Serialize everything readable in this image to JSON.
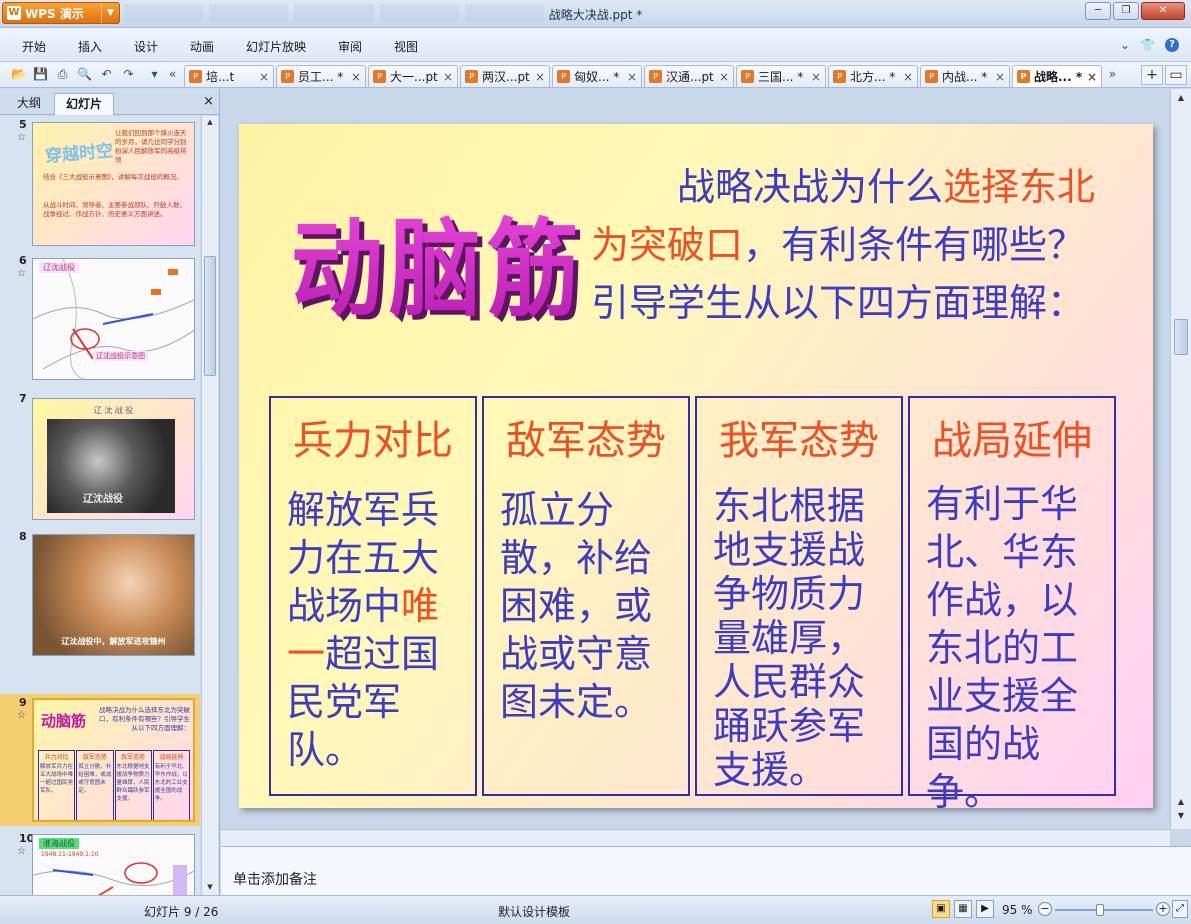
{
  "window": {
    "app_button": "WPS 演示",
    "title": "战略大决战.ppt *",
    "controls": [
      "─",
      "❐",
      "✕"
    ]
  },
  "menu": {
    "items": [
      "开始",
      "插入",
      "设计",
      "动画",
      "幻灯片放映",
      "审阅",
      "视图"
    ]
  },
  "doc_tabs": [
    {
      "label": "培...t",
      "active": false
    },
    {
      "label": "员工... *",
      "active": false
    },
    {
      "label": "大一...pt",
      "active": false
    },
    {
      "label": "两汉...pt",
      "active": false
    },
    {
      "label": "匈奴... *",
      "active": false
    },
    {
      "label": "汉通...pt",
      "active": false
    },
    {
      "label": "三国... *",
      "active": false
    },
    {
      "label": "北方... *",
      "active": false
    },
    {
      "label": "内战... *",
      "active": false
    },
    {
      "label": "战略... *",
      "active": true
    }
  ],
  "left_panel": {
    "tab_outline": "大纲",
    "tab_slides": "幻灯片",
    "close": "×",
    "thumbnails": [
      {
        "num": "5",
        "title": "穿越时空",
        "text1": "让我们回到那个烽火连天的岁月，请几位同学分别扮演人民解放军的高级将领",
        "text2": "结合《三大战役示意图》，讲解每次战役的概况。",
        "text3": "从战斗时间、领导者、主要参战部队、歼敌人数、战争经过、作战方针、历史意义方面讲述。"
      },
      {
        "num": "6",
        "label": "辽沈战役",
        "caption": "辽沈战役示意图"
      },
      {
        "num": "7",
        "caption": "辽 沈 战 役",
        "photo_text": "辽沈战役"
      },
      {
        "num": "8",
        "caption": "辽沈战役中，解放军进攻锦州"
      },
      {
        "num": "9",
        "big": "动脑筋",
        "question": "战略决战为什么选择东北为突破口，有利条件有哪些？引导学生从以下四方面理解：",
        "cols": [
          {
            "h": "兵力对比",
            "b": "解放军兵力在五大战场中唯一超过国民党军队。"
          },
          {
            "h": "敌军态势",
            "b": "孤立分散，补给困难，或战或守意图未定。"
          },
          {
            "h": "我军态势",
            "b": "东北根据地支援战争物质力量雄厚，人民群众踊跃参军支援。"
          },
          {
            "h": "战局延伸",
            "b": "有利于华北、华东作战，以东北的工业支援全国的战争。"
          }
        ]
      },
      {
        "num": "10",
        "label": "淮海战役",
        "sub": "1948.11-1949.1.10"
      }
    ]
  },
  "slide": {
    "big_title": "动脑筋",
    "question_pre": "战略决战为什么",
    "question_red1": "选择",
    "question_red2": "东北为突破口",
    "question_post": "，有利条件有哪些？引导学生从以下四方面理解：",
    "columns": [
      {
        "head": "兵力对比",
        "body_pre": "解放军兵力在五大战场中",
        "body_red": "唯一",
        "body_post": "超过国民党军队。"
      },
      {
        "head": "敌军态势",
        "body_pre": "孤立分散，补给困难，或战或守意图未定。",
        "body_red": "",
        "body_post": ""
      },
      {
        "head": "我军态势",
        "body_pre": "东北根据地支援战争物质力量雄厚，人民群众踊跃参军支援。",
        "body_red": "",
        "body_post": ""
      },
      {
        "head": "战局延伸",
        "body_pre": "有利于华北、华东作战，以东北的工业支援全国的战争。",
        "body_red": "",
        "body_post": ""
      }
    ]
  },
  "notes": {
    "placeholder": "单击添加备注"
  },
  "status": {
    "slide_counter": "幻灯片 9 / 26",
    "template": "默认设计模板",
    "zoom": "95 %",
    "zoom_fraction": 0.45
  },
  "colors": {
    "accent_orange": "#e0700e",
    "title_magenta": "#d030c8",
    "body_blue": "#3d3dc2",
    "highlight_red": "#f05020"
  }
}
